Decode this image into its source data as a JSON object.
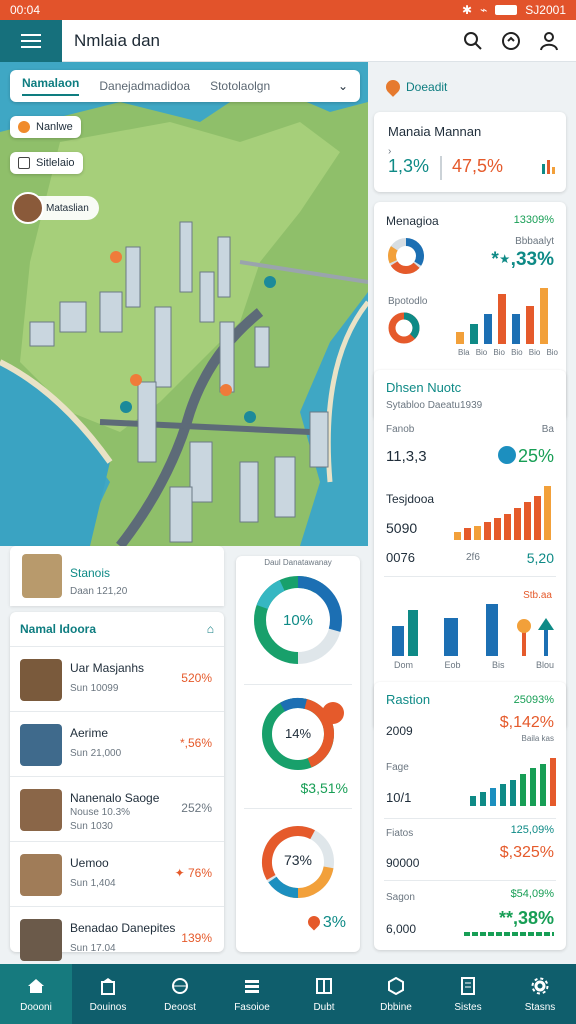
{
  "status": {
    "time": "00:04",
    "right": "SJ2001"
  },
  "app": {
    "title": "Nmlaia dan"
  },
  "map_tabs": [
    "Namalaon",
    "Danejadmadidoa",
    "Stotolaolgn"
  ],
  "map_chips": {
    "first": "Nanlwe",
    "second": "Sitlelaio"
  },
  "map_callout": "Mataslian",
  "right": {
    "badge": "Doeadit",
    "card1": {
      "title": "Manaia Mannan",
      "val_a": "1,3%",
      "val_b": "47,5%"
    },
    "card2": {
      "title": "Menagioa",
      "top_value": "13309%",
      "small": "Bbbaalyt",
      "big": "*⋆,33%",
      "bars_label": "Bpotodlo",
      "x_labels": [
        "Bla",
        "Bio",
        "Bio",
        "Bio",
        "Bio",
        "Bio"
      ]
    },
    "card3": {
      "title": "Dhsen Nuotc",
      "subtitle": "Sytabloo Daeatu1939",
      "row1_label": "Fanob",
      "row1_small": "Ba",
      "row1_value": "11,3,3",
      "row1_pct": "25%",
      "row2_label": "Tesjdooa",
      "row2_value": "5090",
      "row2b_value": "0076",
      "row2b_mid": "2f6",
      "row2b_right": "5,20",
      "row3_small": "Stb.aa",
      "x_labels": [
        "Dom",
        "Eob",
        "Bis",
        "Blou"
      ]
    },
    "card4": {
      "title": "Rastion",
      "top": "25093%",
      "row_a": "2009",
      "row_a_val": "$,142%",
      "row_a_small": "Baila kas",
      "row_b_label": "Fage",
      "row_b_value": "10/1",
      "row_c_label": "Fiatos",
      "row_c_top": "125,09%",
      "row_c_value": "90000",
      "row_c_val": "$,325%",
      "row_d_label": "Sagon",
      "row_d_top": "$54,09%",
      "row_d_value": "6,000",
      "row_d_val": "**,38%"
    }
  },
  "place_header": {
    "title": "Stanois",
    "sub": "Daan 121,20"
  },
  "places": {
    "header": "Namal Idoora",
    "rows": [
      {
        "name": "Uar Masjanhs",
        "sub": "Sun 10099",
        "value": "520%"
      },
      {
        "name": "Aerime",
        "sub": "Sun 21,000",
        "value": "*,56%"
      },
      {
        "name": "Nanenalo Saoge",
        "sub": "Nouse 10.3%",
        "sub2": "Sun 1030",
        "value": "252%"
      },
      {
        "name": "Uemoo",
        "sub": "Sun 1,404",
        "value": "✦ 76%"
      },
      {
        "name": "Benadao Danepites",
        "sub": "Sun 17.04",
        "value": "139%"
      }
    ]
  },
  "donuts": {
    "caption": "Daul Danatawanay",
    "d1": "10%",
    "d2": "14%",
    "d2_sub": "$3,51%",
    "d3": "73%",
    "d3_sub": "3%"
  },
  "nav": [
    "Doooni",
    "Douinos",
    "Deoost",
    "Fasoioe",
    "Dubt",
    "Dbbine",
    "Sistes",
    "Stasns"
  ]
}
